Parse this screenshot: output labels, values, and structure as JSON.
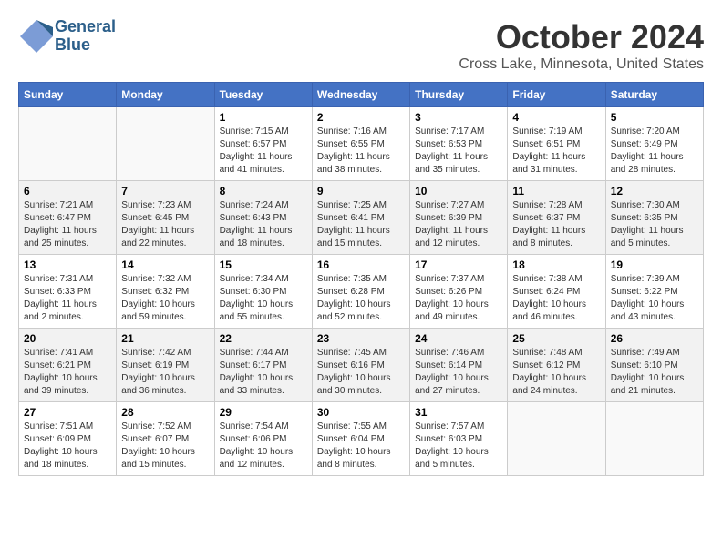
{
  "logo": {
    "line1": "General",
    "line2": "Blue"
  },
  "title": "October 2024",
  "location": "Cross Lake, Minnesota, United States",
  "weekdays": [
    "Sunday",
    "Monday",
    "Tuesday",
    "Wednesday",
    "Thursday",
    "Friday",
    "Saturday"
  ],
  "weeks": [
    [
      {
        "day": "",
        "sunrise": "",
        "sunset": "",
        "daylight": ""
      },
      {
        "day": "",
        "sunrise": "",
        "sunset": "",
        "daylight": ""
      },
      {
        "day": "1",
        "sunrise": "Sunrise: 7:15 AM",
        "sunset": "Sunset: 6:57 PM",
        "daylight": "Daylight: 11 hours and 41 minutes."
      },
      {
        "day": "2",
        "sunrise": "Sunrise: 7:16 AM",
        "sunset": "Sunset: 6:55 PM",
        "daylight": "Daylight: 11 hours and 38 minutes."
      },
      {
        "day": "3",
        "sunrise": "Sunrise: 7:17 AM",
        "sunset": "Sunset: 6:53 PM",
        "daylight": "Daylight: 11 hours and 35 minutes."
      },
      {
        "day": "4",
        "sunrise": "Sunrise: 7:19 AM",
        "sunset": "Sunset: 6:51 PM",
        "daylight": "Daylight: 11 hours and 31 minutes."
      },
      {
        "day": "5",
        "sunrise": "Sunrise: 7:20 AM",
        "sunset": "Sunset: 6:49 PM",
        "daylight": "Daylight: 11 hours and 28 minutes."
      }
    ],
    [
      {
        "day": "6",
        "sunrise": "Sunrise: 7:21 AM",
        "sunset": "Sunset: 6:47 PM",
        "daylight": "Daylight: 11 hours and 25 minutes."
      },
      {
        "day": "7",
        "sunrise": "Sunrise: 7:23 AM",
        "sunset": "Sunset: 6:45 PM",
        "daylight": "Daylight: 11 hours and 22 minutes."
      },
      {
        "day": "8",
        "sunrise": "Sunrise: 7:24 AM",
        "sunset": "Sunset: 6:43 PM",
        "daylight": "Daylight: 11 hours and 18 minutes."
      },
      {
        "day": "9",
        "sunrise": "Sunrise: 7:25 AM",
        "sunset": "Sunset: 6:41 PM",
        "daylight": "Daylight: 11 hours and 15 minutes."
      },
      {
        "day": "10",
        "sunrise": "Sunrise: 7:27 AM",
        "sunset": "Sunset: 6:39 PM",
        "daylight": "Daylight: 11 hours and 12 minutes."
      },
      {
        "day": "11",
        "sunrise": "Sunrise: 7:28 AM",
        "sunset": "Sunset: 6:37 PM",
        "daylight": "Daylight: 11 hours and 8 minutes."
      },
      {
        "day": "12",
        "sunrise": "Sunrise: 7:30 AM",
        "sunset": "Sunset: 6:35 PM",
        "daylight": "Daylight: 11 hours and 5 minutes."
      }
    ],
    [
      {
        "day": "13",
        "sunrise": "Sunrise: 7:31 AM",
        "sunset": "Sunset: 6:33 PM",
        "daylight": "Daylight: 11 hours and 2 minutes."
      },
      {
        "day": "14",
        "sunrise": "Sunrise: 7:32 AM",
        "sunset": "Sunset: 6:32 PM",
        "daylight": "Daylight: 10 hours and 59 minutes."
      },
      {
        "day": "15",
        "sunrise": "Sunrise: 7:34 AM",
        "sunset": "Sunset: 6:30 PM",
        "daylight": "Daylight: 10 hours and 55 minutes."
      },
      {
        "day": "16",
        "sunrise": "Sunrise: 7:35 AM",
        "sunset": "Sunset: 6:28 PM",
        "daylight": "Daylight: 10 hours and 52 minutes."
      },
      {
        "day": "17",
        "sunrise": "Sunrise: 7:37 AM",
        "sunset": "Sunset: 6:26 PM",
        "daylight": "Daylight: 10 hours and 49 minutes."
      },
      {
        "day": "18",
        "sunrise": "Sunrise: 7:38 AM",
        "sunset": "Sunset: 6:24 PM",
        "daylight": "Daylight: 10 hours and 46 minutes."
      },
      {
        "day": "19",
        "sunrise": "Sunrise: 7:39 AM",
        "sunset": "Sunset: 6:22 PM",
        "daylight": "Daylight: 10 hours and 43 minutes."
      }
    ],
    [
      {
        "day": "20",
        "sunrise": "Sunrise: 7:41 AM",
        "sunset": "Sunset: 6:21 PM",
        "daylight": "Daylight: 10 hours and 39 minutes."
      },
      {
        "day": "21",
        "sunrise": "Sunrise: 7:42 AM",
        "sunset": "Sunset: 6:19 PM",
        "daylight": "Daylight: 10 hours and 36 minutes."
      },
      {
        "day": "22",
        "sunrise": "Sunrise: 7:44 AM",
        "sunset": "Sunset: 6:17 PM",
        "daylight": "Daylight: 10 hours and 33 minutes."
      },
      {
        "day": "23",
        "sunrise": "Sunrise: 7:45 AM",
        "sunset": "Sunset: 6:16 PM",
        "daylight": "Daylight: 10 hours and 30 minutes."
      },
      {
        "day": "24",
        "sunrise": "Sunrise: 7:46 AM",
        "sunset": "Sunset: 6:14 PM",
        "daylight": "Daylight: 10 hours and 27 minutes."
      },
      {
        "day": "25",
        "sunrise": "Sunrise: 7:48 AM",
        "sunset": "Sunset: 6:12 PM",
        "daylight": "Daylight: 10 hours and 24 minutes."
      },
      {
        "day": "26",
        "sunrise": "Sunrise: 7:49 AM",
        "sunset": "Sunset: 6:10 PM",
        "daylight": "Daylight: 10 hours and 21 minutes."
      }
    ],
    [
      {
        "day": "27",
        "sunrise": "Sunrise: 7:51 AM",
        "sunset": "Sunset: 6:09 PM",
        "daylight": "Daylight: 10 hours and 18 minutes."
      },
      {
        "day": "28",
        "sunrise": "Sunrise: 7:52 AM",
        "sunset": "Sunset: 6:07 PM",
        "daylight": "Daylight: 10 hours and 15 minutes."
      },
      {
        "day": "29",
        "sunrise": "Sunrise: 7:54 AM",
        "sunset": "Sunset: 6:06 PM",
        "daylight": "Daylight: 10 hours and 12 minutes."
      },
      {
        "day": "30",
        "sunrise": "Sunrise: 7:55 AM",
        "sunset": "Sunset: 6:04 PM",
        "daylight": "Daylight: 10 hours and 8 minutes."
      },
      {
        "day": "31",
        "sunrise": "Sunrise: 7:57 AM",
        "sunset": "Sunset: 6:03 PM",
        "daylight": "Daylight: 10 hours and 5 minutes."
      },
      {
        "day": "",
        "sunrise": "",
        "sunset": "",
        "daylight": ""
      },
      {
        "day": "",
        "sunrise": "",
        "sunset": "",
        "daylight": ""
      }
    ]
  ]
}
